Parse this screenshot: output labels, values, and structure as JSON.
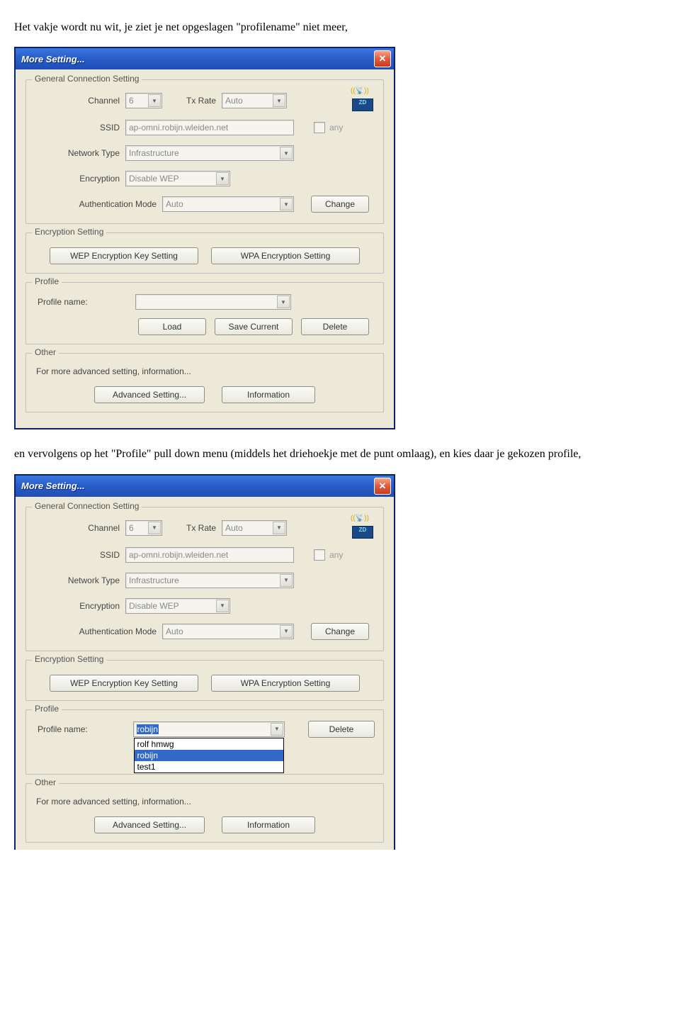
{
  "text1": "Het vakje wordt nu wit, je ziet je net opgeslagen \"profilename\" niet meer,",
  "text2": "en vervolgens op het \"Profile\" pull down menu (middels het driehoekje met de punt omlaag), en kies daar je gekozen profile,",
  "dialog": {
    "title": "More Setting...",
    "group_general": "General Connection Setting",
    "channel_label": "Channel",
    "channel_val": "6",
    "txrate_label": "Tx Rate",
    "txrate_val": "Auto",
    "ssid_label": "SSID",
    "ssid_val": "ap-omni.robijn.wleiden.net",
    "any_label": "any",
    "nettype_label": "Network Type",
    "nettype_val": "Infrastructure",
    "enc_label": "Encryption",
    "enc_val": "Disable WEP",
    "auth_label": "Authentication Mode",
    "auth_val": "Auto",
    "change_btn": "Change",
    "group_enc": "Encryption Setting",
    "wep_btn": "WEP Encryption Key Setting",
    "wpa_btn": "WPA Encryption Setting",
    "group_profile": "Profile",
    "profile_label": "Profile name:",
    "load_btn": "Load",
    "save_btn": "Save Current",
    "delete_btn": "Delete",
    "group_other": "Other",
    "other_text": "For more advanced setting, information...",
    "adv_btn": "Advanced Setting...",
    "info_btn": "Information",
    "device_label": "ZD"
  },
  "dialog2": {
    "profile_val": "robijn",
    "options": [
      "rolf hmwg",
      "robijn",
      "test1"
    ]
  }
}
